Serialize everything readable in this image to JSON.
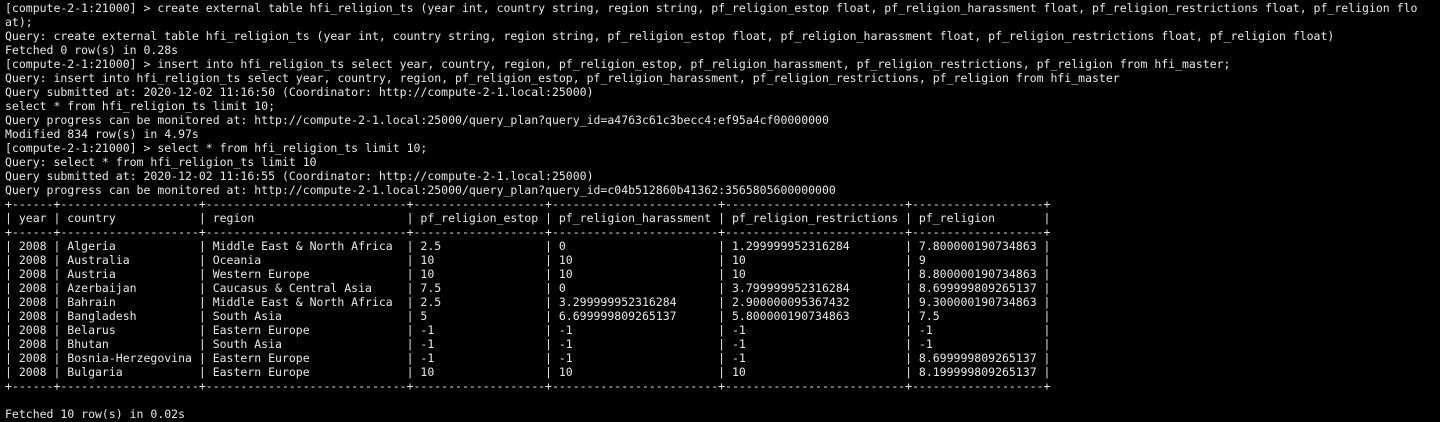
{
  "terminal": {
    "background": "#000000",
    "foreground": "#e8e8e8",
    "lines": [
      "[compute-2-1:21000] > create external table hfi_religion_ts (year int, country string, region string, pf_religion_estop float, pf_religion_harassment float, pf_religion_restrictions float, pf_religion flo",
      "at);",
      "Query: create external table hfi_religion_ts (year int, country string, region string, pf_religion_estop float, pf_religion_harassment float, pf_religion_restrictions float, pf_religion float)",
      "Fetched 0 row(s) in 0.28s",
      "[compute-2-1:21000] > insert into hfi_religion_ts select year, country, region, pf_religion_estop, pf_religion_harassment, pf_religion_restrictions, pf_religion from hfi_master;",
      "Query: insert into hfi_religion_ts select year, country, region, pf_religion_estop, pf_religion_harassment, pf_religion_restrictions, pf_religion from hfi_master",
      "Query submitted at: 2020-12-02 11:16:50 (Coordinator: http://compute-2-1.local:25000)",
      "select * from hfi_religion_ts limit 10;",
      "Query progress can be monitored at: http://compute-2-1.local:25000/query_plan?query_id=a4763c61c3becc4:ef95a4cf00000000",
      "Modified 834 row(s) in 4.97s",
      "[compute-2-1:21000] > select * from hfi_religion_ts limit 10;",
      "Query: select * from hfi_religion_ts limit 10",
      "Query submitted at: 2020-12-02 11:16:55 (Coordinator: http://compute-2-1.local:25000)",
      "Query progress can be monitored at: http://compute-2-1.local:25000/query_plan?query_id=c04b512860b41362:3565805600000000",
      "+------+--------------------+-----------------------------+-------------------+------------------------+--------------------------+-------------------+",
      "| year | country            | region                      | pf_religion_estop | pf_religion_harassment | pf_religion_restrictions | pf_religion       |",
      "+------+--------------------+-----------------------------+-------------------+------------------------+--------------------------+-------------------+",
      "| 2008 | Algeria            | Middle East & North Africa  | 2.5               | 0                      | 1.299999952316284        | 7.800000190734863 |",
      "| 2008 | Australia          | Oceania                     | 10                | 10                     | 10                       | 9                 |",
      "| 2008 | Austria            | Western Europe              | 10                | 10                     | 10                       | 8.800000190734863 |",
      "| 2008 | Azerbaijan         | Caucasus & Central Asia     | 7.5               | 0                      | 3.799999952316284        | 8.699999809265137 |",
      "| 2008 | Bahrain            | Middle East & North Africa  | 2.5               | 3.299999952316284      | 2.900000095367432        | 9.300000190734863 |",
      "| 2008 | Bangladesh         | South Asia                  | 5                 | 6.699999809265137      | 5.800000190734863        | 7.5               |",
      "| 2008 | Belarus            | Eastern Europe              | -1                | -1                     | -1                       | -1                |",
      "| 2008 | Bhutan             | South Asia                  | -1                | -1                     | -1                       | -1                |",
      "| 2008 | Bosnia-Herzegovina | Eastern Europe              | -1                | -1                     | -1                       | 8.699999809265137 |",
      "| 2008 | Bulgaria           | Eastern Europe              | 10                | 10                     | 10                       | 8.199999809265137 |",
      "+------+--------------------+-----------------------------+-------------------+------------------------+--------------------------+-------------------+",
      "",
      "Fetched 10 row(s) in 0.02s"
    ]
  }
}
